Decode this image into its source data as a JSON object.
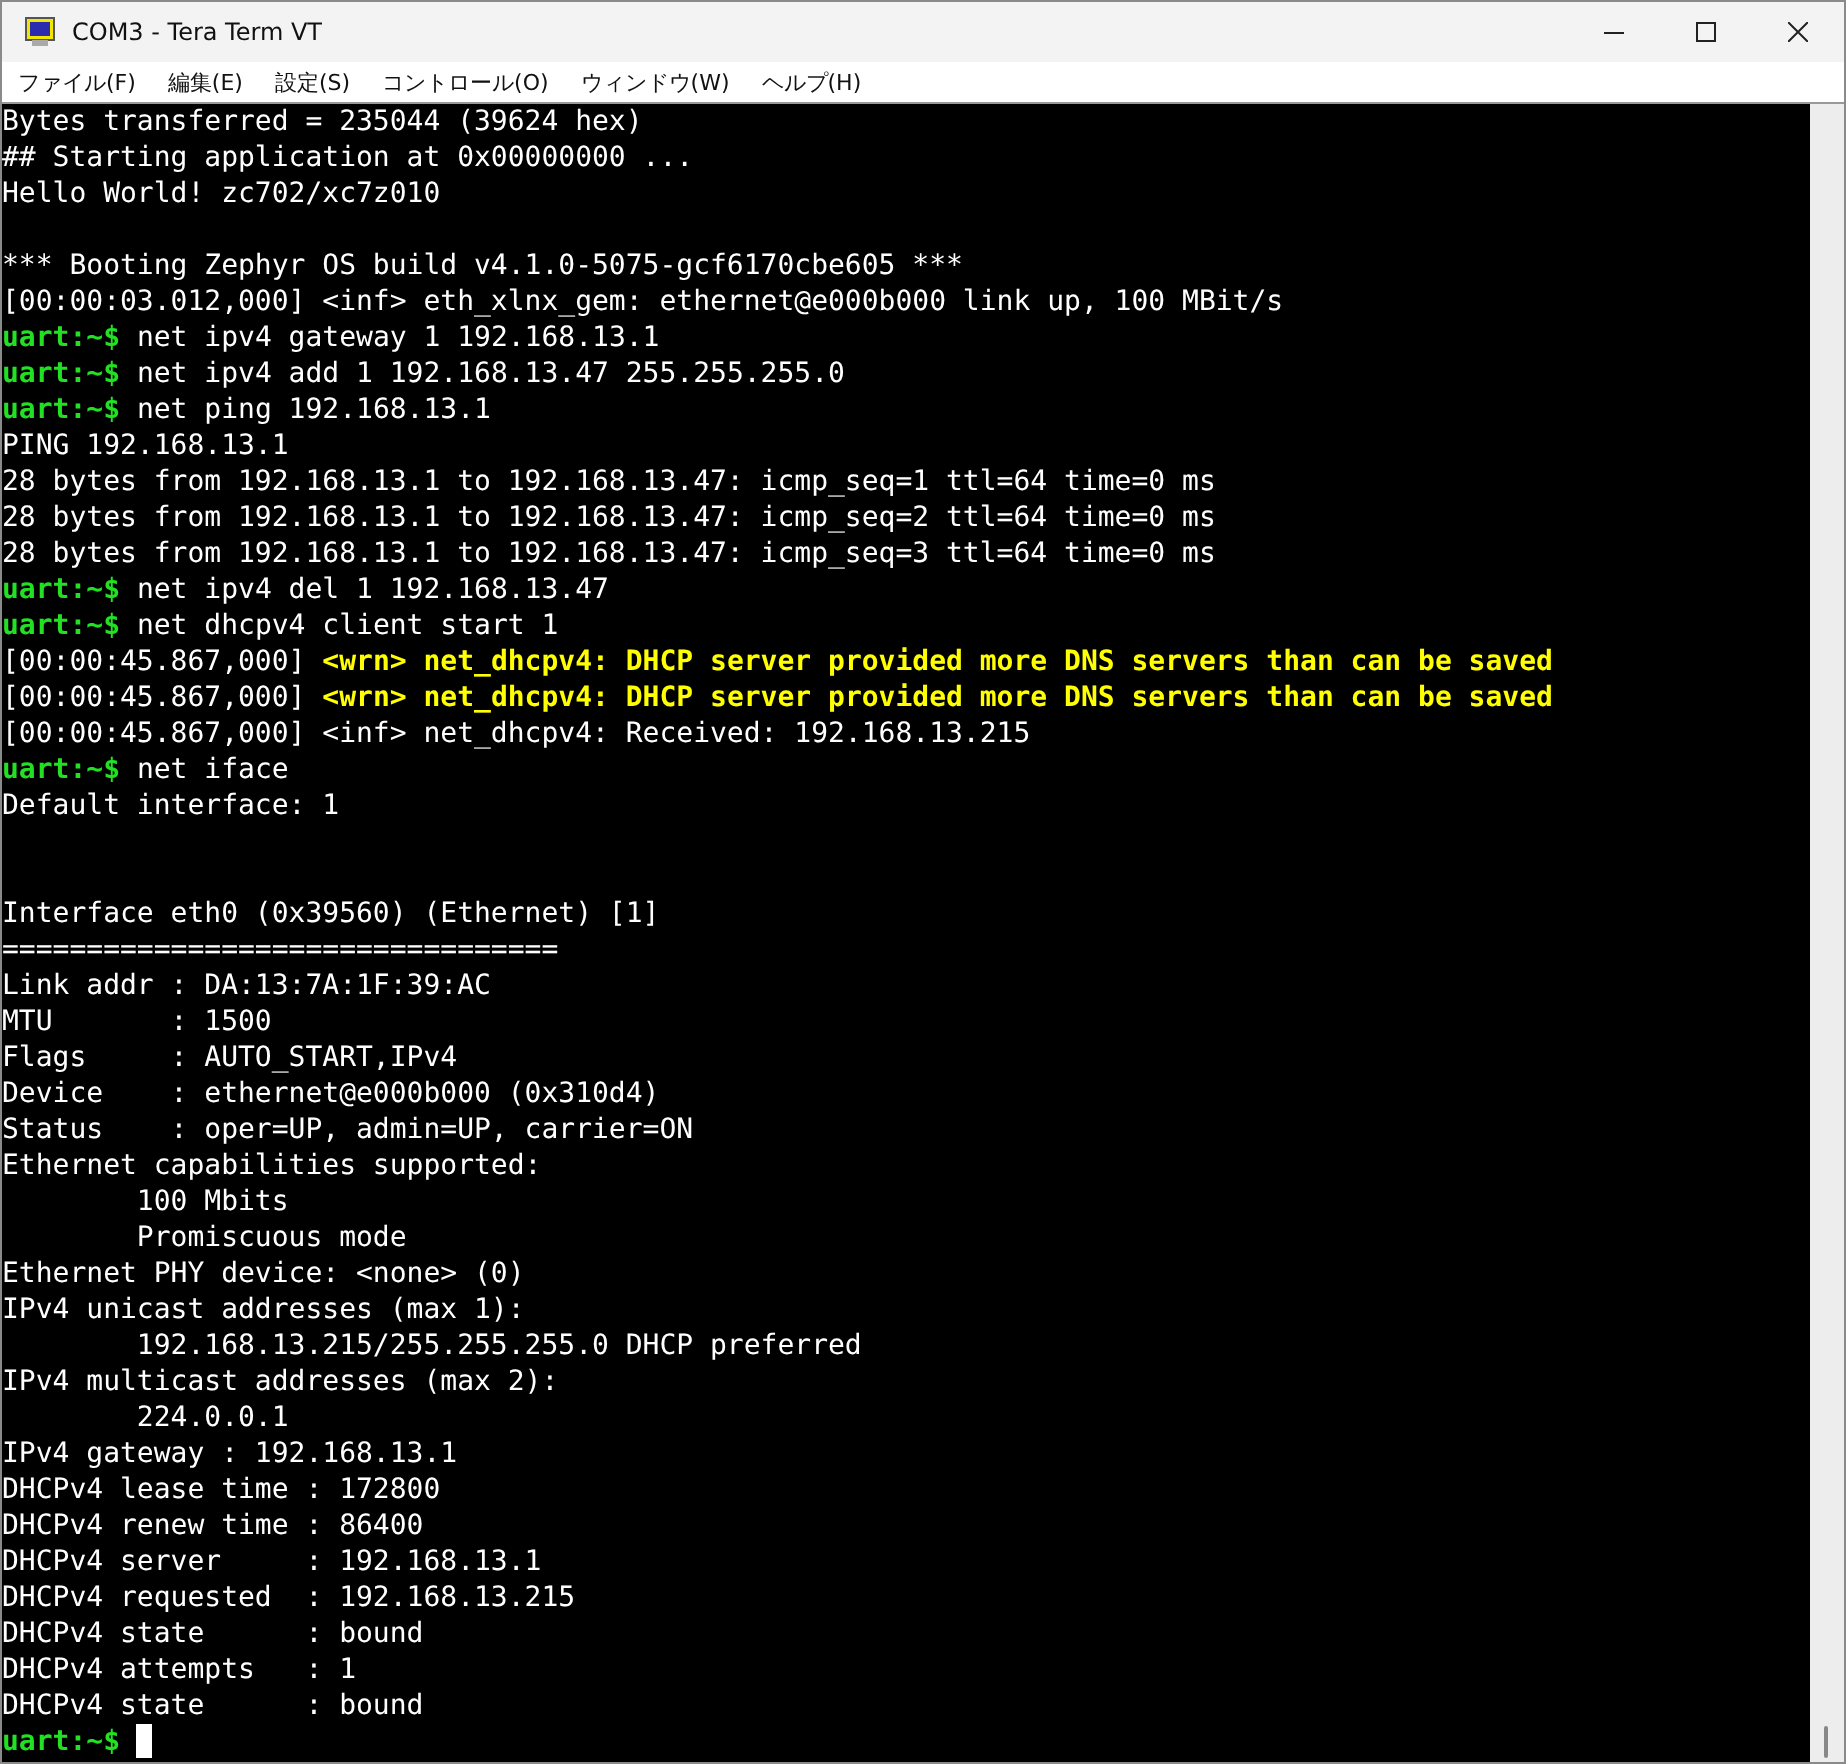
{
  "window": {
    "title": "COM3 - Tera Term VT"
  },
  "menu": [
    {
      "label": "ファイル(F)"
    },
    {
      "label": "編集(E)"
    },
    {
      "label": "設定(S)"
    },
    {
      "label": "コントロール(O)"
    },
    {
      "label": "ウィンドウ(W)"
    },
    {
      "label": "ヘルプ(H)"
    }
  ],
  "terminal": {
    "lines": [
      {
        "segments": [
          {
            "kind": "plain",
            "text": "Bytes transferred = 235044 (39624 hex)"
          }
        ]
      },
      {
        "segments": [
          {
            "kind": "plain",
            "text": "## Starting application at 0x00000000 ..."
          }
        ]
      },
      {
        "segments": [
          {
            "kind": "plain",
            "text": "Hello World! zc702/xc7z010"
          }
        ]
      },
      {
        "kind": "blank"
      },
      {
        "segments": [
          {
            "kind": "plain",
            "text": "*** Booting Zephyr OS build v4.1.0-5075-gcf6170cbe605 ***"
          }
        ]
      },
      {
        "segments": [
          {
            "kind": "plain",
            "text": "[00:00:03.012,000] <inf> eth_xlnx_gem: ethernet@e000b000 link up, 100 MBit/s"
          }
        ]
      },
      {
        "segments": [
          {
            "kind": "prompt",
            "text": "uart:~$"
          },
          {
            "kind": "plain",
            "text": " net ipv4 gateway 1 192.168.13.1"
          }
        ]
      },
      {
        "segments": [
          {
            "kind": "prompt",
            "text": "uart:~$"
          },
          {
            "kind": "plain",
            "text": " net ipv4 add 1 192.168.13.47 255.255.255.0"
          }
        ]
      },
      {
        "segments": [
          {
            "kind": "prompt",
            "text": "uart:~$"
          },
          {
            "kind": "plain",
            "text": " net ping 192.168.13.1"
          }
        ]
      },
      {
        "segments": [
          {
            "kind": "plain",
            "text": "PING 192.168.13.1"
          }
        ]
      },
      {
        "segments": [
          {
            "kind": "plain",
            "text": "28 bytes from 192.168.13.1 to 192.168.13.47: icmp_seq=1 ttl=64 time=0 ms"
          }
        ]
      },
      {
        "segments": [
          {
            "kind": "plain",
            "text": "28 bytes from 192.168.13.1 to 192.168.13.47: icmp_seq=2 ttl=64 time=0 ms"
          }
        ]
      },
      {
        "segments": [
          {
            "kind": "plain",
            "text": "28 bytes from 192.168.13.1 to 192.168.13.47: icmp_seq=3 ttl=64 time=0 ms"
          }
        ]
      },
      {
        "segments": [
          {
            "kind": "prompt",
            "text": "uart:~$"
          },
          {
            "kind": "plain",
            "text": " net ipv4 del 1 192.168.13.47"
          }
        ]
      },
      {
        "segments": [
          {
            "kind": "prompt",
            "text": "uart:~$"
          },
          {
            "kind": "plain",
            "text": " net dhcpv4 client start 1"
          }
        ]
      },
      {
        "segments": [
          {
            "kind": "plain",
            "text": "[00:00:45.867,000] "
          },
          {
            "kind": "warning",
            "text": "<wrn> net_dhcpv4: DHCP server provided more DNS servers than can be saved"
          }
        ]
      },
      {
        "segments": [
          {
            "kind": "plain",
            "text": "[00:00:45.867,000] "
          },
          {
            "kind": "warning",
            "text": "<wrn> net_dhcpv4: DHCP server provided more DNS servers than can be saved"
          }
        ]
      },
      {
        "segments": [
          {
            "kind": "plain",
            "text": "[00:00:45.867,000] <inf> net_dhcpv4: Received: 192.168.13.215"
          }
        ]
      },
      {
        "segments": [
          {
            "kind": "prompt",
            "text": "uart:~$"
          },
          {
            "kind": "plain",
            "text": " net iface"
          }
        ]
      },
      {
        "segments": [
          {
            "kind": "plain",
            "text": "Default interface: 1"
          }
        ]
      },
      {
        "kind": "blank"
      },
      {
        "kind": "blank"
      },
      {
        "segments": [
          {
            "kind": "plain",
            "text": "Interface eth0 (0x39560) (Ethernet) [1]"
          }
        ]
      },
      {
        "segments": [
          {
            "kind": "plain",
            "text": "================================="
          }
        ]
      },
      {
        "segments": [
          {
            "kind": "plain",
            "text": "Link addr : DA:13:7A:1F:39:AC"
          }
        ]
      },
      {
        "segments": [
          {
            "kind": "plain",
            "text": "MTU       : 1500"
          }
        ]
      },
      {
        "segments": [
          {
            "kind": "plain",
            "text": "Flags     : AUTO_START,IPv4"
          }
        ]
      },
      {
        "segments": [
          {
            "kind": "plain",
            "text": "Device    : ethernet@e000b000 (0x310d4)"
          }
        ]
      },
      {
        "segments": [
          {
            "kind": "plain",
            "text": "Status    : oper=UP, admin=UP, carrier=ON"
          }
        ]
      },
      {
        "segments": [
          {
            "kind": "plain",
            "text": "Ethernet capabilities supported:"
          }
        ]
      },
      {
        "segments": [
          {
            "kind": "plain",
            "text": "        100 Mbits"
          }
        ]
      },
      {
        "segments": [
          {
            "kind": "plain",
            "text": "        Promiscuous mode"
          }
        ]
      },
      {
        "segments": [
          {
            "kind": "plain",
            "text": "Ethernet PHY device: <none> (0)"
          }
        ]
      },
      {
        "segments": [
          {
            "kind": "plain",
            "text": "IPv4 unicast addresses (max 1):"
          }
        ]
      },
      {
        "segments": [
          {
            "kind": "plain",
            "text": "        192.168.13.215/255.255.255.0 DHCP preferred"
          }
        ]
      },
      {
        "segments": [
          {
            "kind": "plain",
            "text": "IPv4 multicast addresses (max 2):"
          }
        ]
      },
      {
        "segments": [
          {
            "kind": "plain",
            "text": "        224.0.0.1"
          }
        ]
      },
      {
        "segments": [
          {
            "kind": "plain",
            "text": "IPv4 gateway : 192.168.13.1"
          }
        ]
      },
      {
        "segments": [
          {
            "kind": "plain",
            "text": "DHCPv4 lease time : 172800"
          }
        ]
      },
      {
        "segments": [
          {
            "kind": "plain",
            "text": "DHCPv4 renew time : 86400"
          }
        ]
      },
      {
        "segments": [
          {
            "kind": "plain",
            "text": "DHCPv4 server     : 192.168.13.1"
          }
        ]
      },
      {
        "segments": [
          {
            "kind": "plain",
            "text": "DHCPv4 requested  : 192.168.13.215"
          }
        ]
      },
      {
        "segments": [
          {
            "kind": "plain",
            "text": "DHCPv4 state      : bound"
          }
        ]
      },
      {
        "segments": [
          {
            "kind": "plain",
            "text": "DHCPv4 attempts   : 1"
          }
        ]
      },
      {
        "segments": [
          {
            "kind": "plain",
            "text": "DHCPv4 state      : bound"
          }
        ]
      },
      {
        "segments": [
          {
            "kind": "prompt",
            "text": "uart:~$"
          }
        ],
        "cursor": true
      }
    ]
  }
}
